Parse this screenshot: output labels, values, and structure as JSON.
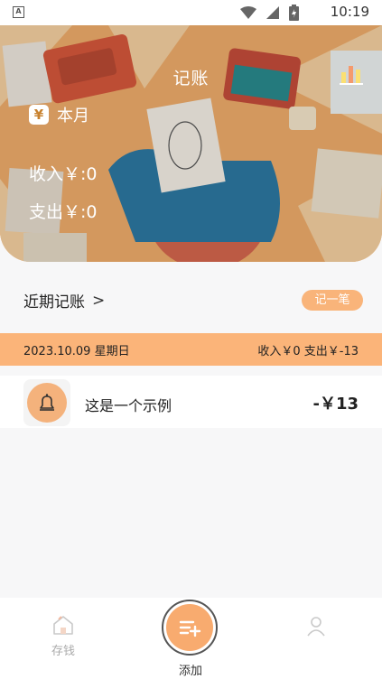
{
  "status_bar": {
    "time": "10:19",
    "app_indicator": "A"
  },
  "header": {
    "title": "记账",
    "period_icon": "yen-icon",
    "period_icon_text": "¥",
    "period_label": "本月",
    "income": "收入￥:0",
    "expense": "支出￥:0",
    "chart_icon": "bar-chart-icon"
  },
  "recent": {
    "title": "近期记账",
    "chevron": ">",
    "record_button": "记一笔"
  },
  "day_group": {
    "date": "2023.10.09 星期日",
    "summary": "收入￥0 支出￥-13"
  },
  "entries": [
    {
      "icon": "bell-icon",
      "label": "这是一个示例",
      "amount": "-￥13"
    }
  ],
  "bottom_nav": {
    "save_label": "存钱",
    "add_label": "添加"
  },
  "colors": {
    "accent": "#f8ab6f",
    "date_bar": "#fbb479"
  }
}
